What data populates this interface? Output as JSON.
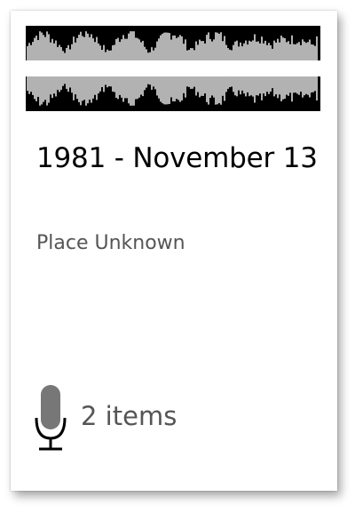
{
  "card": {
    "title": "1981 - November 13",
    "place": "Place Unknown",
    "items_label": "2 items"
  },
  "icons": {
    "waveform": "audio-waveform-thumbnail",
    "microphone": "microphone-icon"
  },
  "colors": {
    "waveform_background": "#000000",
    "waveform_foreground": "#ffffff",
    "title_text": "#000000",
    "secondary_text": "#555555",
    "icon": "#555555"
  }
}
